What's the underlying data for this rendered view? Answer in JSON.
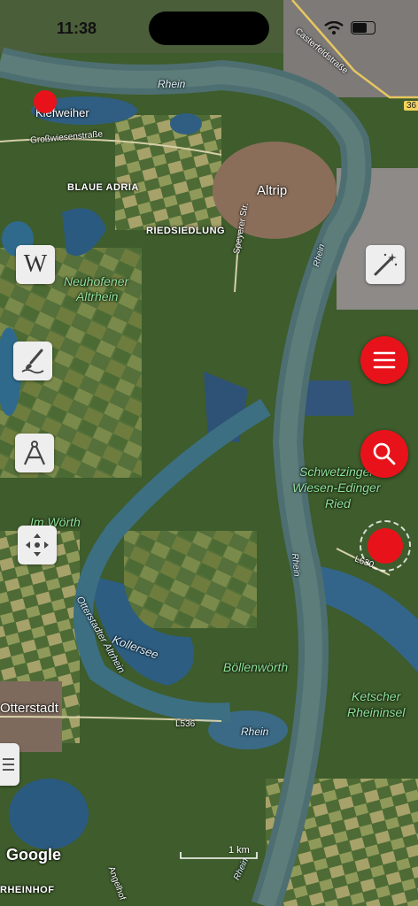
{
  "status_bar": {
    "time": "11:38"
  },
  "map": {
    "labels": {
      "rhein_top": "Rhein",
      "castorfeld": "Casterfeldstraße",
      "route36": "36",
      "weiher": "Kiefweiher",
      "grosswiesen": "Großwiesenstraße",
      "blaue_adria": "BLAUE ADRIA",
      "altrip": "Altrip",
      "riedsiedlung": "RIEDSIEDLUNG",
      "speyerer": "Speyerer Str.",
      "neuhofener": "Neuhofener",
      "altrhein": "Altrhein",
      "rhein_right": "Rhein",
      "schwetzinger1": "Schwetzinger",
      "schwetzinger2": "Wiesen-Edinger",
      "schwetzinger3": "Ried",
      "im_worth": "Im Wörth",
      "rhein_mid": "Rhein",
      "l630": "L630",
      "otterstadter": "Otterstadter Altrhein",
      "kollersee": "Kollersee",
      "bollenworth": "Böllenwörth",
      "ketscher1": "Ketscher",
      "ketscher2": "Rheininsel",
      "otterstadt": "Otterstadt",
      "l536": "L536",
      "rhein_low": "Rhein",
      "angelhof": "Angelhof",
      "rhein_bottom": "Rhein",
      "rheinhof": "RHEINHOF"
    }
  },
  "controls": {
    "wiki_icon_text": "W",
    "scale_label": "1 km",
    "attribution": "Google"
  },
  "colors": {
    "accent": "#e8131a",
    "button_bg": "#eeeeee"
  }
}
